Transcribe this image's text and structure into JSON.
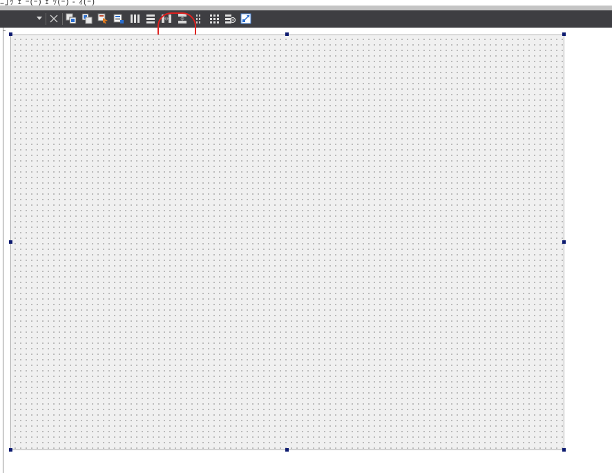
{
  "menu": {
    "cutoff_text": "ﾆ｣ｯ  ｪ ｰ(ｰ)  ｪ ｯ(ｰ)  ‐ ｵ(ｰ)"
  },
  "toolbar": {
    "buttons": [
      {
        "id": "dropdown",
        "icon": "chevron-down-icon"
      },
      {
        "id": "close",
        "icon": "close-icon"
      },
      {
        "id": "bring-to-front",
        "icon": "bring-to-front-icon"
      },
      {
        "id": "send-to-back",
        "icon": "send-to-back-icon"
      },
      {
        "id": "tab-order",
        "icon": "tab-order-icon"
      },
      {
        "id": "property",
        "icon": "property-icon"
      },
      {
        "id": "layout-horizontal",
        "icon": "layout-horizontal-icon"
      },
      {
        "id": "layout-vertical",
        "icon": "layout-vertical-icon"
      },
      {
        "id": "splitter-horizontal",
        "icon": "splitter-horizontal-icon"
      },
      {
        "id": "splitter-vertical",
        "icon": "splitter-vertical-icon"
      },
      {
        "id": "layout-form",
        "icon": "layout-form-icon"
      },
      {
        "id": "layout-grid",
        "icon": "layout-grid-icon"
      },
      {
        "id": "break-layout",
        "icon": "break-layout-icon"
      },
      {
        "id": "adjust-size",
        "icon": "adjust-size-icon"
      }
    ],
    "highlighted": "splitter-vertical",
    "colors": {
      "background": "#3e3e42",
      "highlight": "#e1201e",
      "selection_handle": "#0d1b70",
      "canvas": "#f0f0f0"
    }
  }
}
